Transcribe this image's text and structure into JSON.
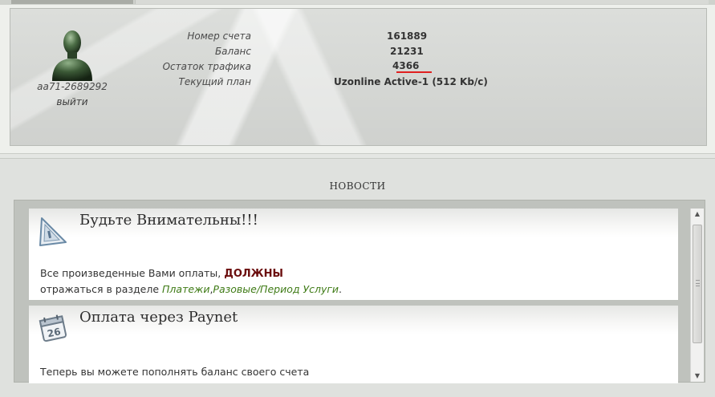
{
  "account": {
    "user_login": "aa71-2689292",
    "logout_label": "выйти",
    "fields": [
      {
        "label": "Номер счета",
        "value": "161889"
      },
      {
        "label": "Баланс",
        "value": "21231"
      },
      {
        "label": "Остаток трафика",
        "value": "4366"
      },
      {
        "label": "Текущий план",
        "value": "Uzonline Active-1 (512 Kb/c)"
      }
    ]
  },
  "news": {
    "heading": "НОВОСТИ",
    "items": [
      {
        "title": "Будьте Внимательны!!!",
        "icon": "warning-triangle-icon",
        "line1_prefix": "Все произведенные Вами оплаты, ",
        "line1_strong": "ДОЛЖНЫ",
        "line2_prefix": "отражаться в разделе ",
        "link1": "Платежи",
        "link_sep": ",",
        "link2": "Разовые/Период Услуги",
        "line2_suffix": "."
      },
      {
        "title": "Оплата через Paynet",
        "icon": "calendar-icon",
        "calendar_day": "26",
        "text": "Теперь вы можете пополнять баланс своего счета"
      }
    ]
  },
  "colors": {
    "underline": "#e02020",
    "strong_text": "#6b0d0d",
    "link": "#3f7b16"
  }
}
